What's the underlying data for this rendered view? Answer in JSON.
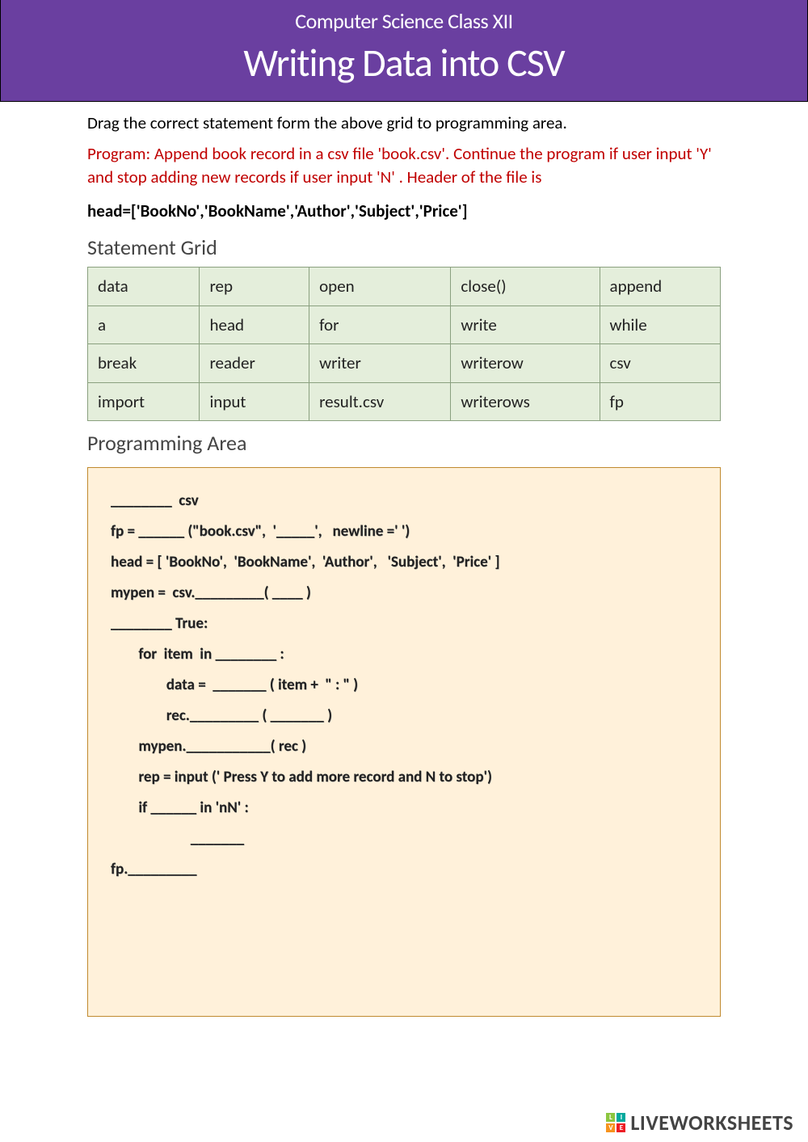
{
  "header": {
    "subtitle": "Computer Science Class XII",
    "title": "Writing Data into CSV"
  },
  "instruction": "Drag the correct statement form the above grid to programming area.",
  "program_desc": "Program:  Append book record in a csv file 'book.csv'.   Continue the program if user input 'Y' and stop adding new records if user input 'N' .  Header of the file is",
  "header_code": "head=['BookNo','BookName','Author','Subject','Price']",
  "sections": {
    "grid_label": "Statement Grid",
    "prog_label": "Programming Area"
  },
  "grid": [
    [
      "data",
      "rep",
      "open",
      "close()",
      "append"
    ],
    [
      "a",
      "head",
      "for",
      "write",
      "while"
    ],
    [
      "break",
      "reader",
      "writer",
      "writerow",
      "csv"
    ],
    [
      "import",
      "input",
      "result.csv",
      "writerows",
      "fp"
    ]
  ],
  "code_lines": [
    "________  csv",
    "fp = ______ (\"book.csv\",  '_____',   newline =' ')",
    "head = [ 'BookNo',  'BookName',  'Author',   'Subject',  'Price' ]",
    "mypen =  csv._________( ____ )",
    "________ True:",
    "        for  item  in ________ :",
    "                data =  _______ ( item +  \" : \" )",
    "                rec._________ ( _______ )",
    "        mypen.___________( rec )",
    "        rep = input (' Press Y to add more record and N to stop')",
    "        if ______ in 'nN' :",
    "                       _______",
    "fp._________"
  ],
  "footer": {
    "brand": "LIVEWORKSHEETS",
    "logo": [
      "L",
      "I",
      "V",
      "E"
    ]
  }
}
